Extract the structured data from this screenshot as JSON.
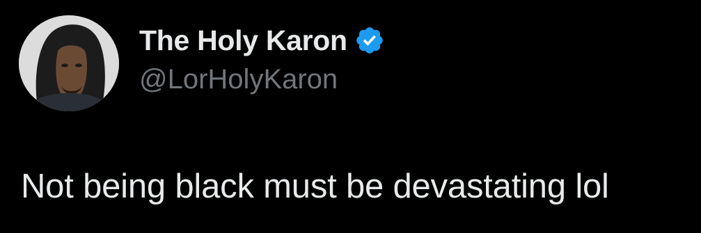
{
  "author": {
    "display_name": "The Holy Karon",
    "handle": "@LorHolyKaron",
    "verified": true,
    "verified_color": "#1d9bf0",
    "avatar_icon": "profile-photo"
  },
  "tweet": {
    "text": "Not being black must be devastating lol"
  },
  "colors": {
    "background": "#000000",
    "primary_text": "#e7e9ea",
    "secondary_text": "#71767b"
  }
}
